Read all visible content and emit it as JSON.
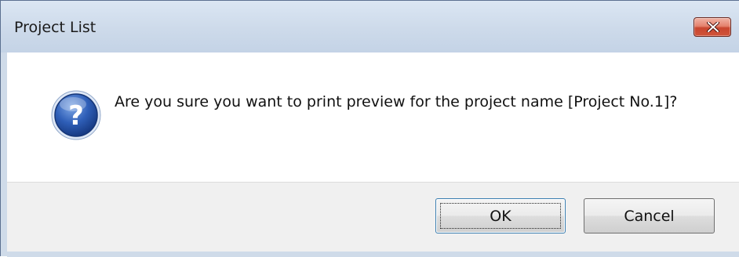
{
  "window": {
    "title": "Project List",
    "close_icon": "close-icon"
  },
  "message": {
    "icon": "question-icon",
    "text": "Are you sure you want to print preview for the project name [Project No.1]?"
  },
  "buttons": {
    "ok_label": "OK",
    "cancel_label": "Cancel"
  },
  "colors": {
    "titlebar": "#cddaea",
    "close_button": "#c9462f",
    "button_area": "#f0f0f0",
    "default_button_border": "#3c7fb1"
  }
}
